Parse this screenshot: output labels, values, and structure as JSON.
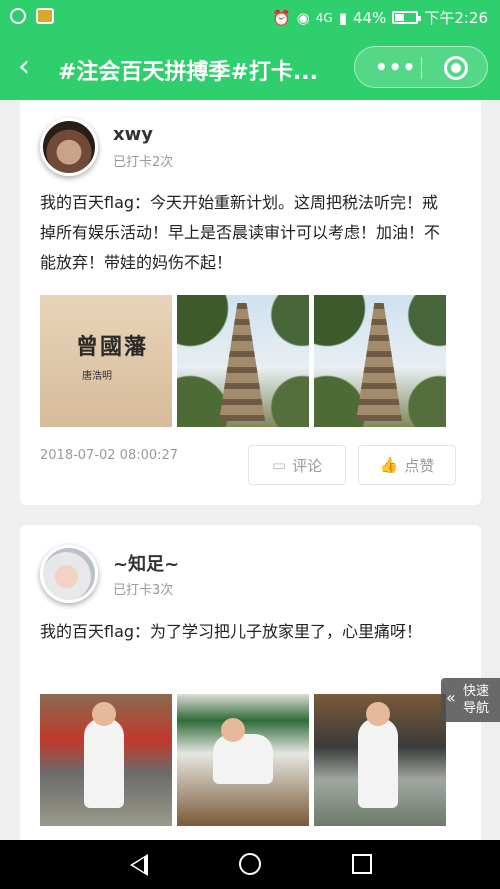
{
  "status_bar": {
    "signal_label": "4G",
    "battery": "44%",
    "time": "下午2:26"
  },
  "title_bar": {
    "back_icon": "chevron-left",
    "title": "#注会百天拼搏季#打卡...",
    "menu_icon": "more-dots",
    "close_icon": "target-circle"
  },
  "posts": [
    {
      "username": "xwy",
      "checkin": "已打卡2次",
      "text": "我的百天flag：今天开始重新计划。这周把税法听完！戒掉所有娱乐活动！早上是否晨读审计可以考虑！加油！不能放弃！带娃的妈伤不起！",
      "photos": [
        {
          "book_title": "曾國藩",
          "book_author": "唐浩明"
        },
        {},
        {}
      ],
      "date": "2018-07-02 08:00:27",
      "comment_label": "评论",
      "like_label": "点赞"
    },
    {
      "username": "~知足~",
      "checkin": "已打卡3次",
      "text": "我的百天flag：为了学习把儿子放家里了，心里痛呀！",
      "photos": [
        {},
        {},
        {}
      ]
    }
  ],
  "quick_nav": {
    "label": "快速导航",
    "icon": "double-chevron-left"
  },
  "colors": {
    "brand_green": "#2fcf6d",
    "card_bg": "#ffffff",
    "page_bg": "#efefef"
  }
}
